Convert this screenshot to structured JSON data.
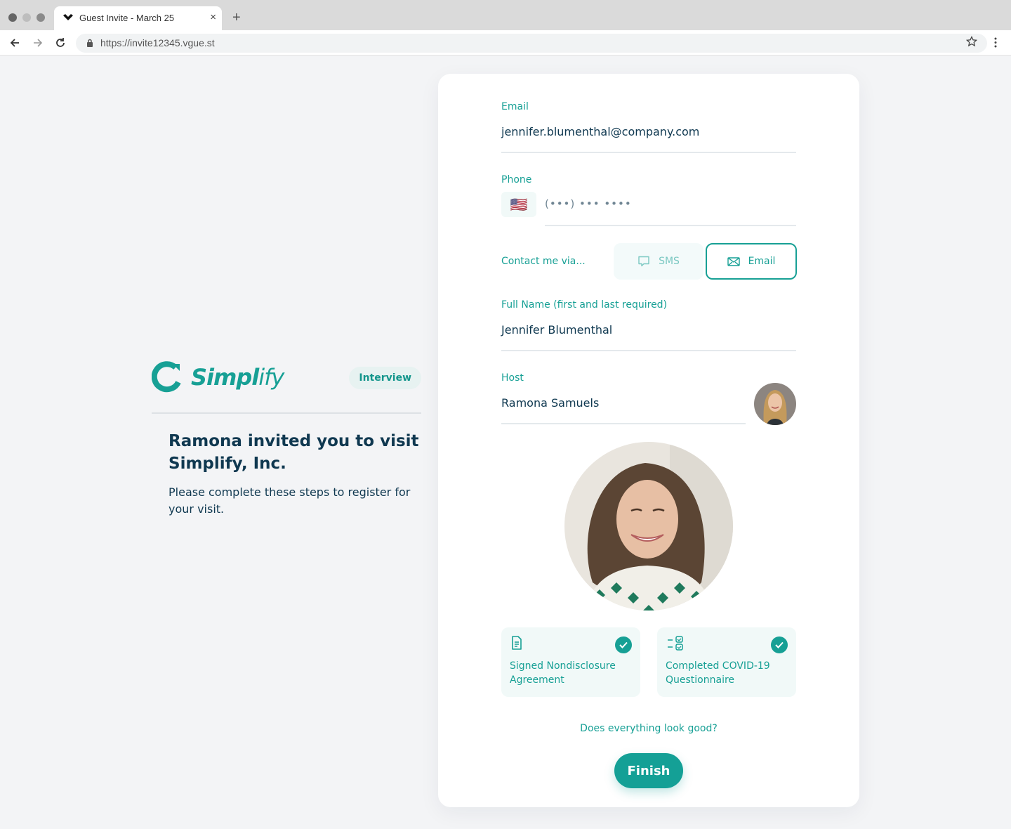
{
  "browser": {
    "tab_title": "Guest Invite - March 25",
    "tab_close": "×",
    "new_tab": "+",
    "url": "https://invite12345.vgue.st",
    "traffic_lights": [
      "#656565",
      "#bdbdbd",
      "#8a8a8a"
    ]
  },
  "brand": {
    "logo_bold": "Simpl",
    "logo_light": "ify",
    "badge": "Interview",
    "accent_color": "#17a095"
  },
  "intro": {
    "headline": "Ramona invited you to visit Simplify, Inc.",
    "subtext": "Please complete these steps to register for your visit."
  },
  "form": {
    "email": {
      "label": "Email",
      "value": "jennifer.blumenthal@company.com"
    },
    "phone": {
      "label": "Phone",
      "country_flag": "🇺🇸",
      "placeholder": "(•••) ••• ••••"
    },
    "contact": {
      "label": "Contact me via...",
      "options": [
        {
          "label": "SMS",
          "icon": "chat-bubble-icon",
          "selected": false
        },
        {
          "label": "Email",
          "icon": "envelope-icon",
          "selected": true
        }
      ]
    },
    "full_name": {
      "label": "Full Name (first and last required)",
      "value": "Jennifer Blumenthal"
    },
    "host": {
      "label": "Host",
      "value": "Ramona Samuels"
    }
  },
  "steps": [
    {
      "label": "Signed Nondisclosure Agreement",
      "icon": "document-icon",
      "completed": true
    },
    {
      "label": "Completed COVID-19 Questionnaire",
      "icon": "checklist-icon",
      "completed": true
    }
  ],
  "footer": {
    "question": "Does everything look good?",
    "finish_label": "Finish"
  }
}
